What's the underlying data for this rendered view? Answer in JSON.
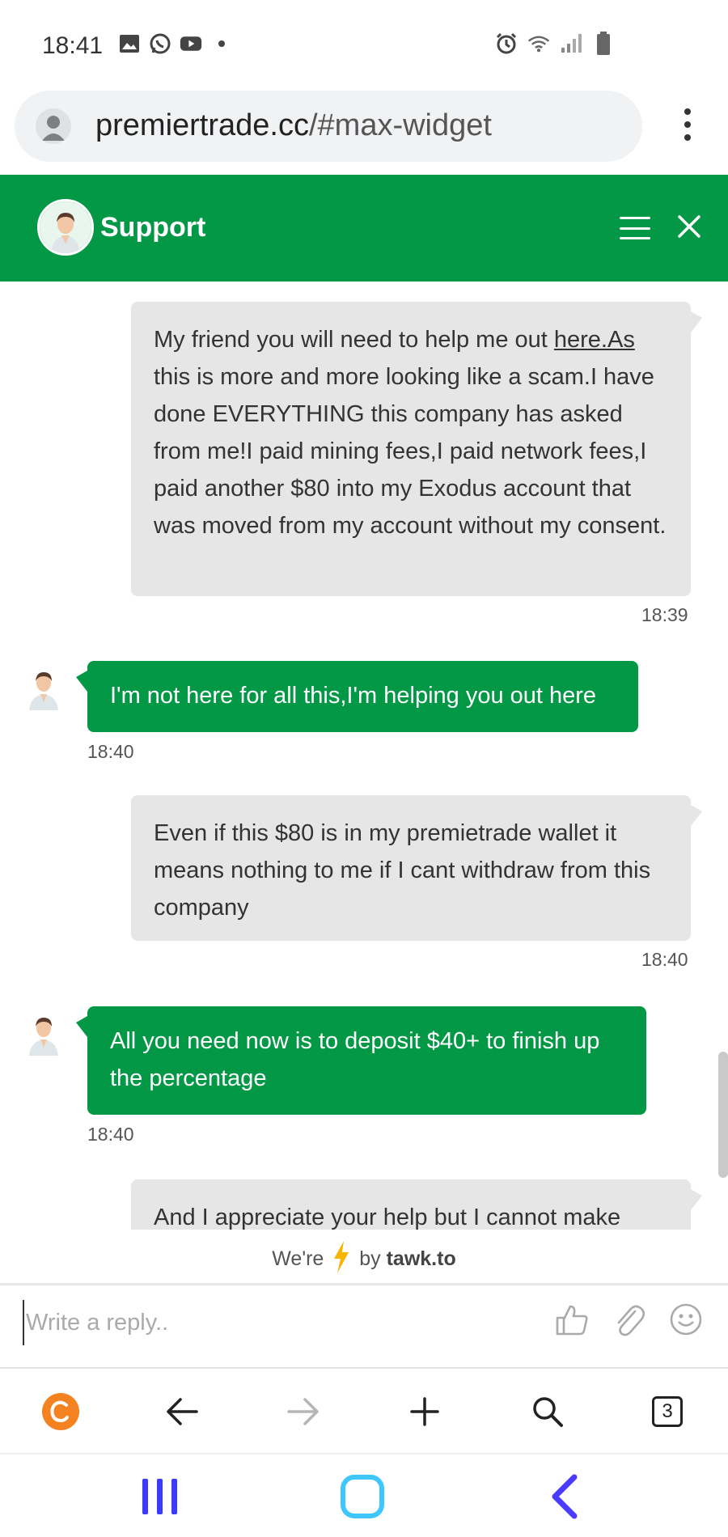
{
  "status_bar": {
    "time": "18:41",
    "left_icons": [
      "gallery-icon",
      "whatsapp-icon",
      "youtube-icon"
    ],
    "right_icons": [
      "alarm-icon",
      "wifi-icon",
      "signal-icon",
      "battery-icon"
    ]
  },
  "browser": {
    "url_host": "premiertrade.cc",
    "url_path": "/#max-widget",
    "tab_count": "3"
  },
  "chat": {
    "title": "Support",
    "accent_color": "#039845",
    "messages": [
      {
        "from": "visitor",
        "text_a": "My friend you will need to help me out ",
        "link": "here.As",
        "text_b": " this is more and more looking like a scam.I have done EVERYTHING this company has asked from me!I paid mining fees,I paid network fees,I paid another $80 into my Exodus account that was moved from my account without my consent.",
        "time": "18:39"
      },
      {
        "from": "agent",
        "text": "I'm not here for all this,I'm helping you out here",
        "time": "18:40"
      },
      {
        "from": "visitor",
        "text": "Even if this $80 is in my premietrade wallet it means nothing to me if I cant withdraw from this company",
        "time": "18:40"
      },
      {
        "from": "agent",
        "text": "All you need now is to deposit $40+ to finish up the percentage",
        "time": "18:40"
      },
      {
        "from": "visitor",
        "text": "And I appreciate your help but I cannot make"
      }
    ],
    "powered": {
      "prefix": "We're",
      "suffix": "by",
      "brand": "tawk.to"
    },
    "reply_placeholder": "Write a reply.."
  }
}
